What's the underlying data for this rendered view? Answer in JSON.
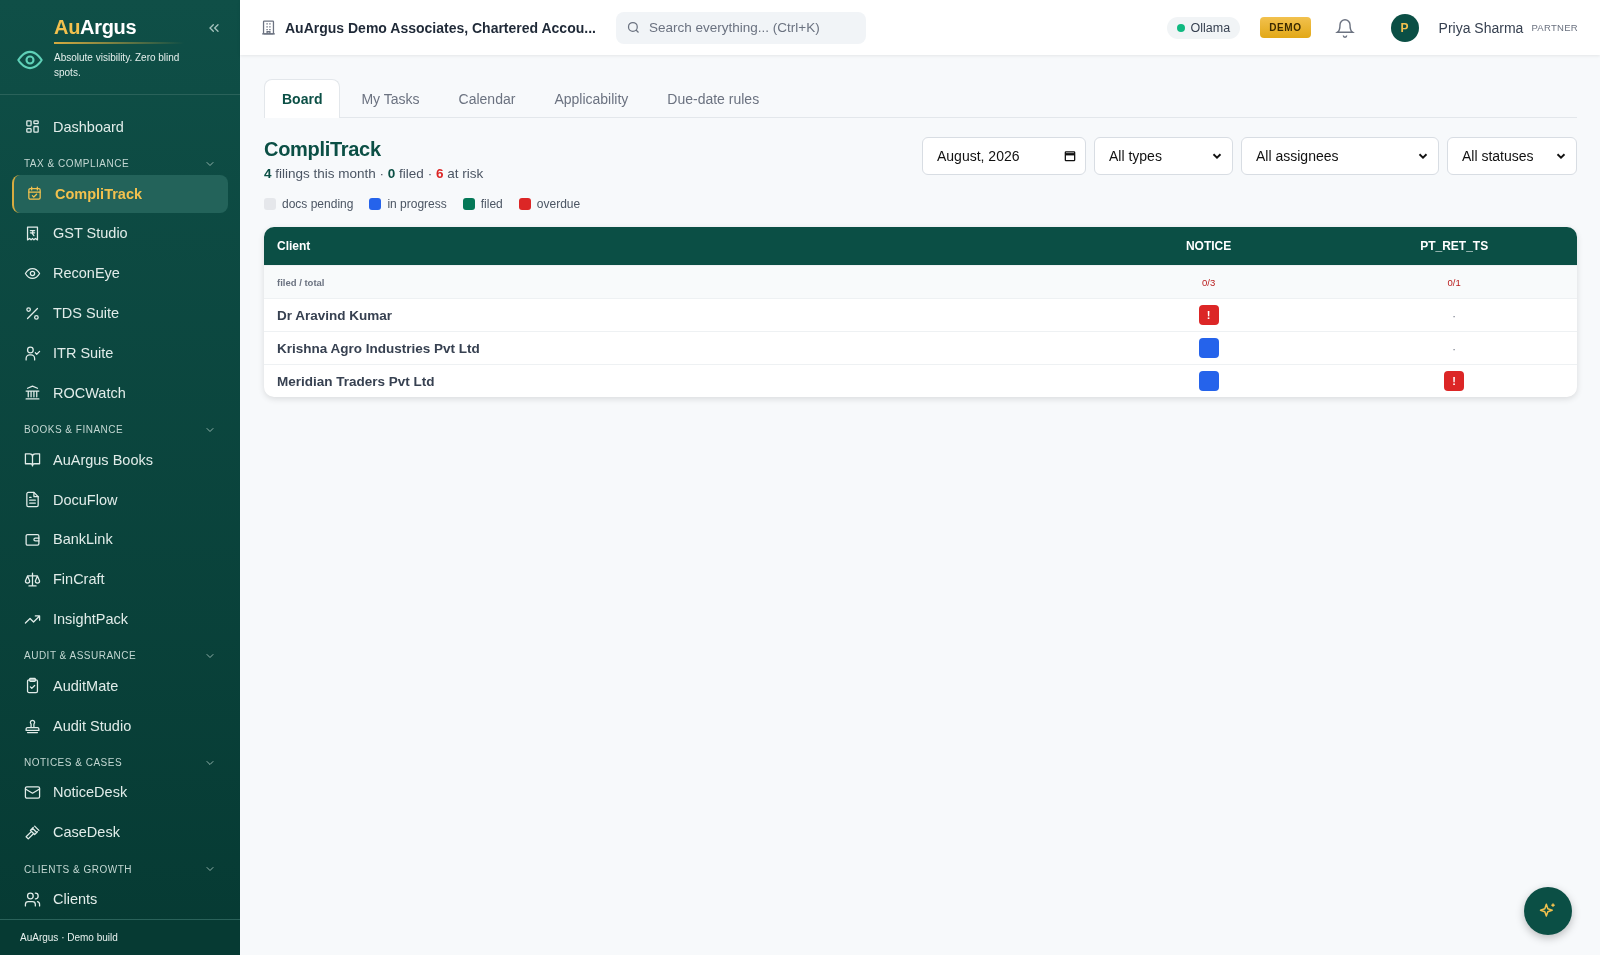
{
  "sidebar": {
    "brand": {
      "name_part_1": "Au",
      "name_part_2": "Argus",
      "tagline": "Absolute visibility. Zero blind spots."
    },
    "top_items": [
      {
        "label": "Dashboard",
        "selected": false
      }
    ],
    "sections": [
      {
        "title": "TAX & COMPLIANCE",
        "expanded": true,
        "items": [
          {
            "label": "CompliTrack",
            "selected": true
          },
          {
            "label": "GST Studio",
            "selected": false
          },
          {
            "label": "ReconEye",
            "selected": false
          },
          {
            "label": "TDS Suite",
            "selected": false
          },
          {
            "label": "ITR Suite",
            "selected": false
          },
          {
            "label": "ROCWatch",
            "selected": false
          }
        ]
      },
      {
        "title": "BOOKS & FINANCE",
        "expanded": true,
        "items": [
          {
            "label": "AuArgus Books",
            "selected": false
          },
          {
            "label": "DocuFlow",
            "selected": false
          },
          {
            "label": "BankLink",
            "selected": false
          },
          {
            "label": "FinCraft",
            "selected": false
          },
          {
            "label": "InsightPack",
            "selected": false
          }
        ]
      },
      {
        "title": "AUDIT & ASSURANCE",
        "expanded": true,
        "items": [
          {
            "label": "AuditMate",
            "selected": false
          },
          {
            "label": "Audit Studio",
            "selected": false
          }
        ]
      },
      {
        "title": "NOTICES & CASES",
        "expanded": true,
        "items": [
          {
            "label": "NoticeDesk",
            "selected": false
          },
          {
            "label": "CaseDesk",
            "selected": false
          }
        ]
      },
      {
        "title": "CLIENTS & GROWTH",
        "expanded": true,
        "items": [
          {
            "label": "Clients",
            "selected": false
          }
        ]
      }
    ],
    "footer": "AuArgus · Demo build"
  },
  "topbar": {
    "org": "AuArgus Demo Associates, Chartered Accou...",
    "search": {
      "placeholder": "Search everything...  (Ctrl+K)"
    },
    "model_status": {
      "label": "Ollama",
      "color": "#10b981"
    },
    "badge": "DEMO",
    "user": {
      "initial": "P",
      "name": "Priya Sharma",
      "role": "PARTNER"
    }
  },
  "tabs": [
    {
      "label": "Board",
      "selected": true
    },
    {
      "label": "My Tasks",
      "selected": false
    },
    {
      "label": "Calendar",
      "selected": false
    },
    {
      "label": "Applicability",
      "selected": false
    },
    {
      "label": "Due-date rules",
      "selected": false
    }
  ],
  "page": {
    "title": "CompliTrack",
    "summary": [
      {
        "text": "**4** filings this month",
        "kind": "total"
      },
      {
        "text": "**0** filed",
        "kind": "filed"
      },
      {
        "text": "**6** at risk",
        "kind": "risk"
      }
    ],
    "separator": "·"
  },
  "filters": {
    "month": "August, 2026",
    "selects": [
      "All types",
      "All assignees",
      "All statuses"
    ]
  },
  "legend": [
    {
      "label": "docs pending",
      "color": "#e5e7eb"
    },
    {
      "label": "in progress",
      "color": "#2563eb"
    },
    {
      "label": "filed",
      "color": "#047857"
    },
    {
      "label": "overdue",
      "color": "#dc2626"
    }
  ],
  "table": {
    "columns": [
      "Client",
      "NOTICE",
      "PT_RET_TS"
    ],
    "subheader": [
      "filed / total",
      "0/3",
      "0/1"
    ],
    "rows": [
      {
        "cells": [
          {
            "kind": "name",
            "text": "Dr Aravind Kumar"
          },
          {
            "kind": "overdue",
            "text": "!"
          },
          {
            "kind": "empty",
            "text": "·"
          }
        ]
      },
      {
        "cells": [
          {
            "kind": "name",
            "text": "Krishna Agro Industries Pvt Ltd"
          },
          {
            "kind": "in_progress"
          },
          {
            "kind": "empty",
            "text": "·"
          }
        ]
      },
      {
        "cells": [
          {
            "kind": "name",
            "text": "Meridian Traders Pvt Ltd"
          },
          {
            "kind": "in_progress"
          },
          {
            "kind": "overdue",
            "text": "!"
          }
        ]
      }
    ]
  }
}
